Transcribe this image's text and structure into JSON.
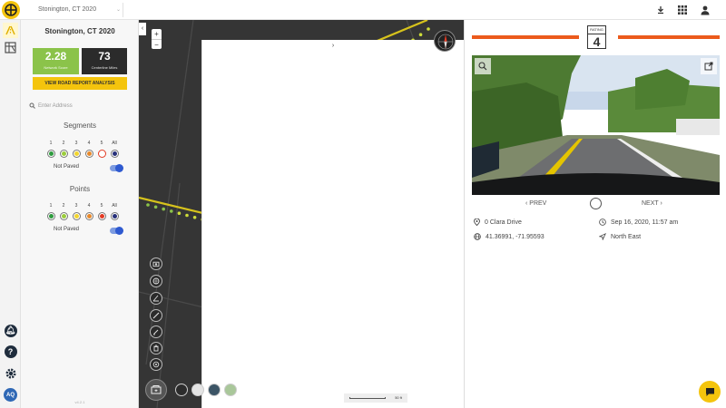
{
  "header": {
    "project_select": "Stonington, CT 2020",
    "icons": [
      "download-icon",
      "grid-icon",
      "user-icon"
    ]
  },
  "rail": {
    "icons": [
      "road-rating-icon",
      "map-grid-icon",
      "notifications-icon",
      "help-icon",
      "settings-icon"
    ],
    "avatar_initials": "AQ"
  },
  "sidebar": {
    "city": "Stonington, CT 2020",
    "score_value": "2.28",
    "score_label": "Network Score",
    "miles_value": "73",
    "miles_label": "Centerline Miles",
    "report_button": "VIEW ROAD REPORT ANALYSIS",
    "address_placeholder": "Enter Address",
    "segments_title": "Segments",
    "points_title": "Points",
    "levels": [
      "1",
      "2",
      "3",
      "4",
      "5",
      "All"
    ],
    "level_colors": [
      "#2e9b3e",
      "#9bcc3c",
      "#f2d52e",
      "#e8892a",
      "#e23b24",
      "#27307a"
    ],
    "not_paved_label": "Not Paved",
    "not_paved_on": true,
    "version": "v4.2.1"
  },
  "map": {
    "zoom_in": "+",
    "zoom_out": "−",
    "scale_label": "50 ft",
    "collapse_left": "‹",
    "collapse_right": "›",
    "tools": [
      "camera-icon",
      "aperture-icon",
      "angle-icon",
      "ruler-icon",
      "edit-icon",
      "trash-icon",
      "target-icon"
    ],
    "basemaps": [
      "dark-basemap",
      "streets-basemap",
      "satellite-basemap",
      "terrain-basemap"
    ]
  },
  "detail": {
    "rating_label": "RATING",
    "rating_value": "4",
    "prev_label": "‹ PREV",
    "next_label": "NEXT ›",
    "address": "0 Clara Drive",
    "coordinates": "41.36991, -71.95593",
    "datetime": "Sep 16, 2020, 11:57 am",
    "heading": "North East"
  }
}
